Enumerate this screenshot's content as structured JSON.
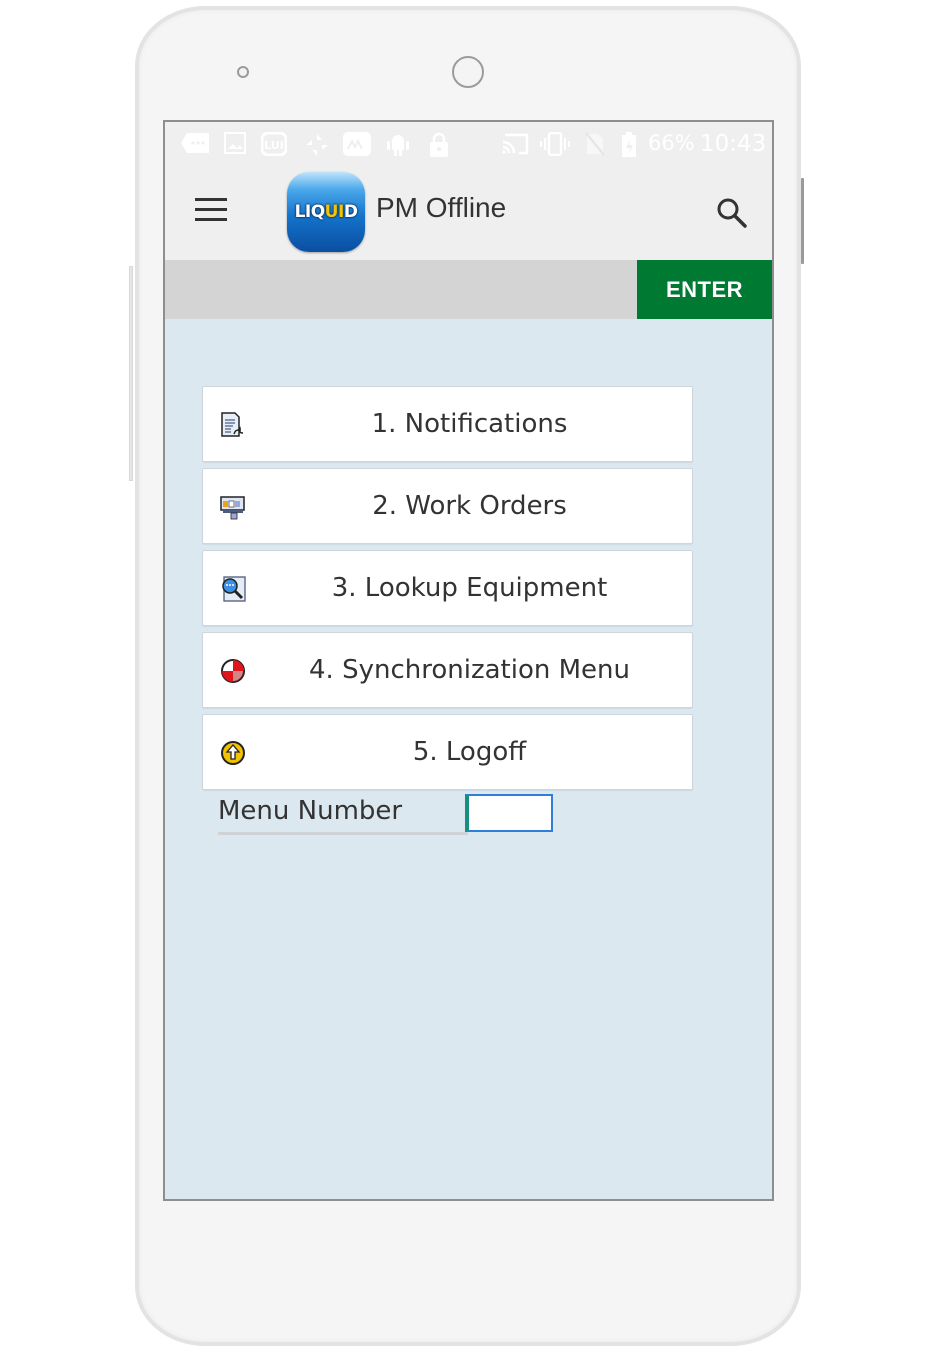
{
  "statusbar": {
    "icons": [
      "messages-icon",
      "image-icon",
      "lui-app-icon",
      "pinwheel-icon",
      "maps-icon",
      "android-icon",
      "lock-icon",
      "cast-icon",
      "vibrate-icon",
      "no-sim-icon",
      "battery-charging-icon"
    ],
    "battery": "66%",
    "time": "10:43"
  },
  "appbar": {
    "logo_text_left": "LIQ",
    "logo_text_highlight": "UI",
    "logo_text_right": "D",
    "title": "PM Offline",
    "menu_icon": "hamburger-icon",
    "search_icon": "search-icon"
  },
  "toolbar": {
    "enter_label": "ENTER",
    "enter_color": "#007a33"
  },
  "menu": {
    "items": [
      {
        "label": "1. Notifications",
        "icon": "notification-document-icon"
      },
      {
        "label": "2. Work Orders",
        "icon": "work-order-icon"
      },
      {
        "label": "3. Lookup Equipment",
        "icon": "lookup-equipment-icon"
      },
      {
        "label": "4. Synchronization Menu",
        "icon": "sync-icon"
      },
      {
        "label": "5. Logoff",
        "icon": "logoff-icon"
      }
    ]
  },
  "menu_number": {
    "label": "Menu Number",
    "value": ""
  }
}
